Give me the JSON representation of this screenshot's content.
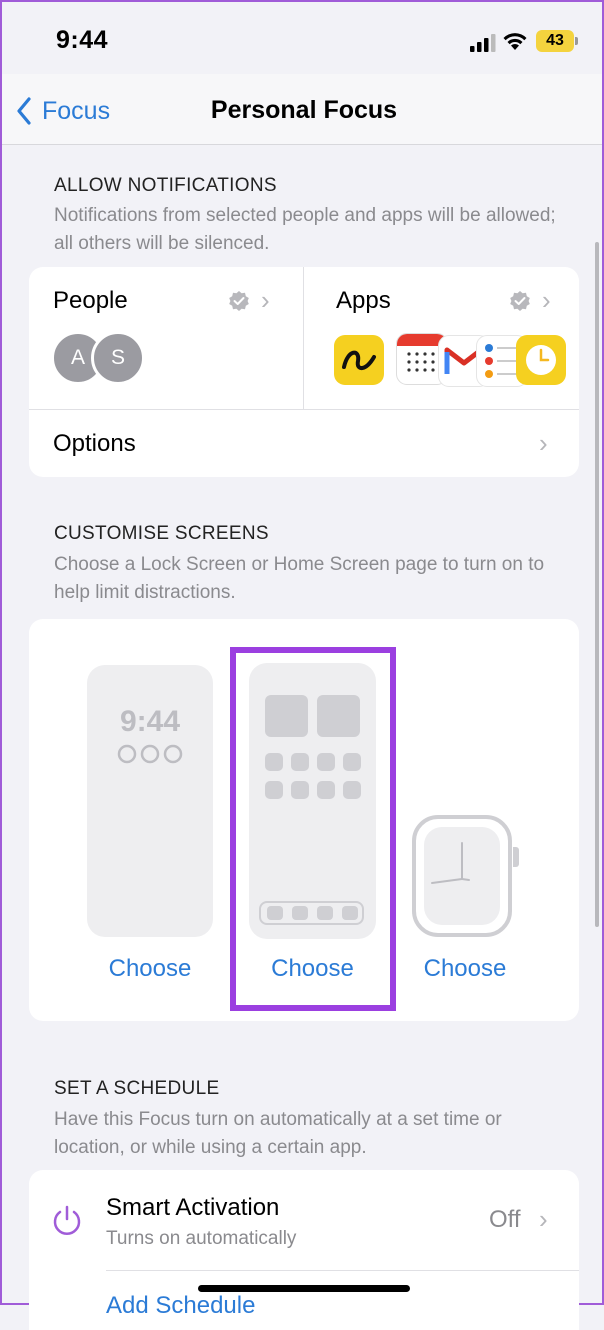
{
  "status": {
    "time": "9:44",
    "battery": "43"
  },
  "nav": {
    "back_label": "Focus",
    "title": "Personal Focus"
  },
  "allow": {
    "header": "ALLOW NOTIFICATIONS",
    "description": "Notifications from selected people and apps will be allowed; all others will be silenced.",
    "people_label": "People",
    "people_avatars": [
      "A",
      "S"
    ],
    "apps_label": "Apps",
    "options_label": "Options"
  },
  "customise": {
    "header": "CUSTOMISE SCREENS",
    "description": "Choose a Lock Screen or Home Screen page to turn on to help limit distractions.",
    "lock_time": "9:44",
    "choose_lock": "Choose",
    "choose_home": "Choose",
    "choose_watch": "Choose",
    "highlight_color": "#9b3fe0"
  },
  "schedule": {
    "header": "SET A SCHEDULE",
    "description": "Have this Focus turn on automatically at a set time or location, or while using a certain app.",
    "smart_title": "Smart Activation",
    "smart_subtitle": "Turns on automatically",
    "smart_value": "Off",
    "add_schedule": "Add Schedule"
  },
  "colors": {
    "accent": "#2b7bd6",
    "purple": "#9b3fe0"
  }
}
